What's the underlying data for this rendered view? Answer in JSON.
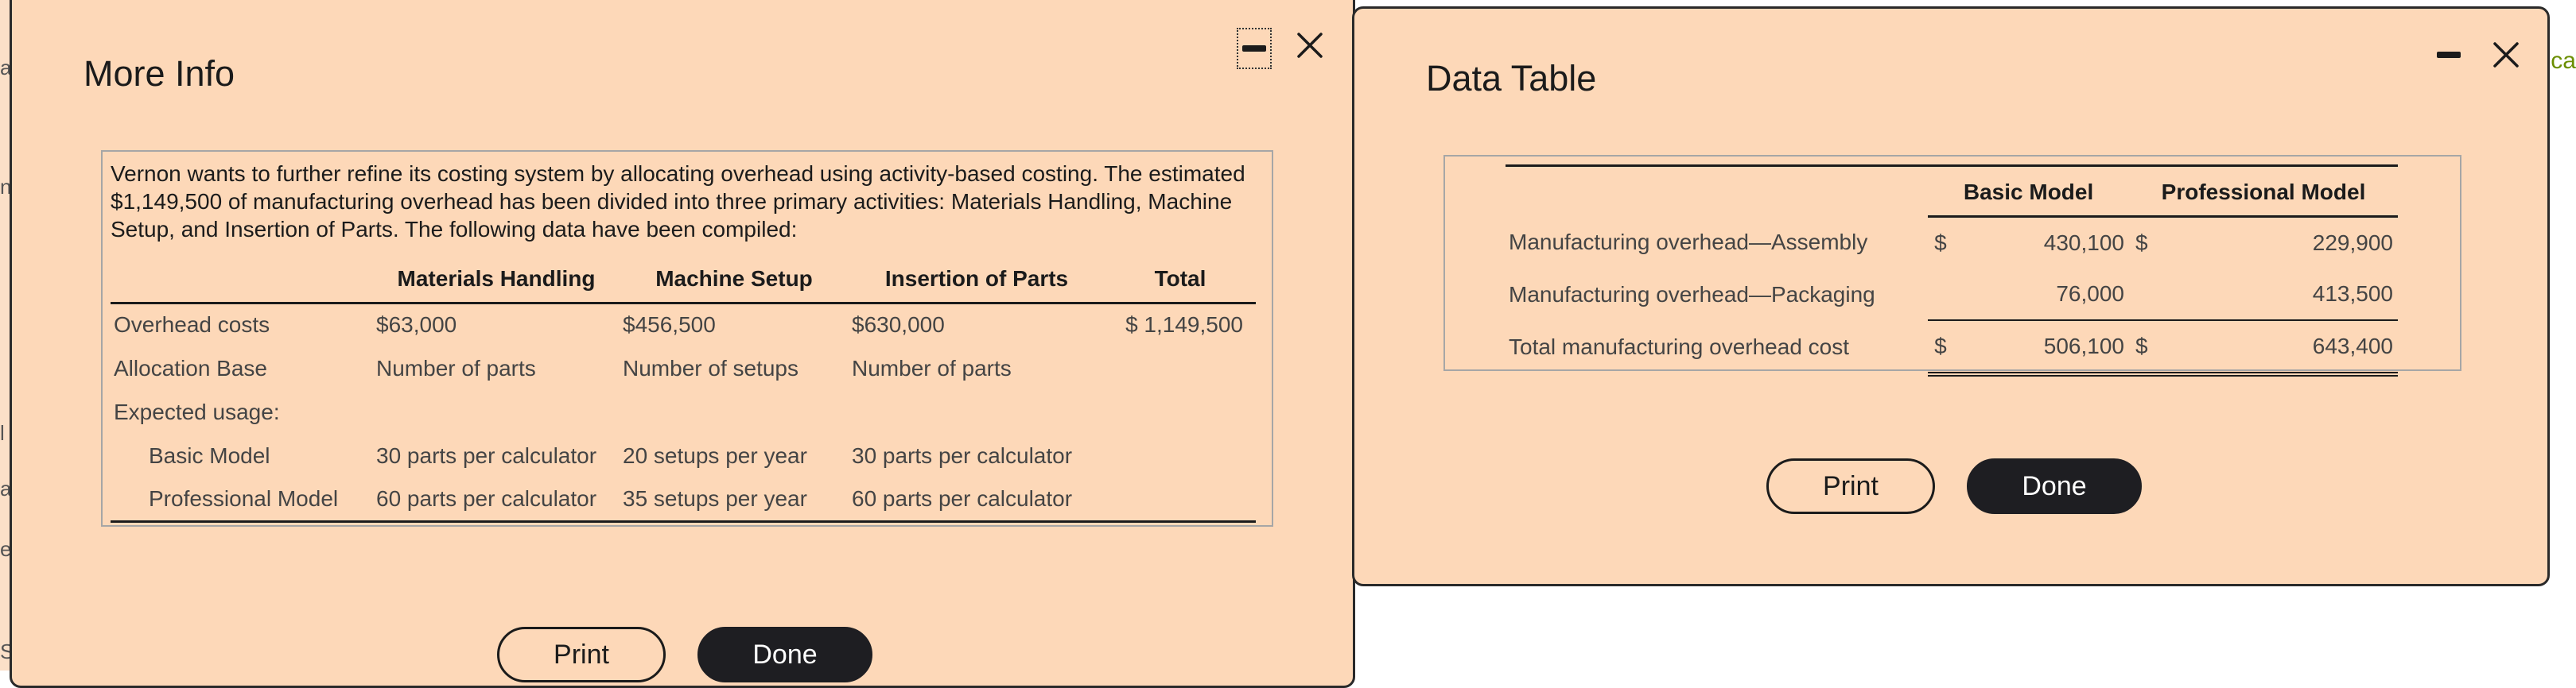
{
  "background": {
    "left_fragments": [
      "a",
      "n",
      "l",
      "a",
      "e",
      "S"
    ],
    "right_fragment": "oca"
  },
  "more_info": {
    "title": "More Info",
    "description": "Vernon wants to further refine its costing system by allocating overhead using activity-based costing. The estimated $1,149,500 of manufacturing overhead has been divided into three primary activities: Materials Handling, Machine Setup, and Insertion of Parts. The following data have been compiled:",
    "columns": [
      "",
      "Materials Handling",
      "Machine Setup",
      "Insertion of Parts",
      "Total"
    ],
    "rows": [
      {
        "label": "Overhead costs",
        "materials": "$63,000",
        "setup": "$456,500",
        "insertion": "$630,000",
        "total": "$ 1,149,500"
      },
      {
        "label": "Allocation Base",
        "materials": "Number of parts",
        "setup": "Number of setups",
        "insertion": "Number of parts",
        "total": ""
      },
      {
        "label": "Expected usage:",
        "materials": "",
        "setup": "",
        "insertion": "",
        "total": ""
      },
      {
        "label": "Basic Model",
        "materials": "30 parts per calculator",
        "setup": "20 setups per year",
        "insertion": "30 parts per calculator",
        "total": ""
      },
      {
        "label": "Professional Model",
        "materials": "60 parts per calculator",
        "setup": "35 setups per year",
        "insertion": "60 parts per calculator",
        "total": ""
      }
    ],
    "print_label": "Print",
    "done_label": "Done"
  },
  "data_table": {
    "title": "Data Table",
    "columns": [
      "",
      "Basic Model",
      "Professional Model"
    ],
    "rows": [
      {
        "label": "Manufacturing overhead—Assembly",
        "basic_sign": "$",
        "basic": "430,100",
        "pro_sign": "$",
        "pro": "229,900"
      },
      {
        "label": "Manufacturing overhead—Packaging",
        "basic_sign": "",
        "basic": "76,000",
        "pro_sign": "",
        "pro": "413,500"
      },
      {
        "label": "Total manufacturing overhead cost",
        "basic_sign": "$",
        "basic": "506,100",
        "pro_sign": "$",
        "pro": "643,400"
      }
    ],
    "print_label": "Print",
    "done_label": "Done"
  },
  "icons": {
    "minimize": "minimize-icon",
    "close": "close-icon"
  },
  "colors": {
    "dialog_background": "#fdd8b8",
    "primary_button": "#1e1e22",
    "text": "#1b1b1b"
  }
}
